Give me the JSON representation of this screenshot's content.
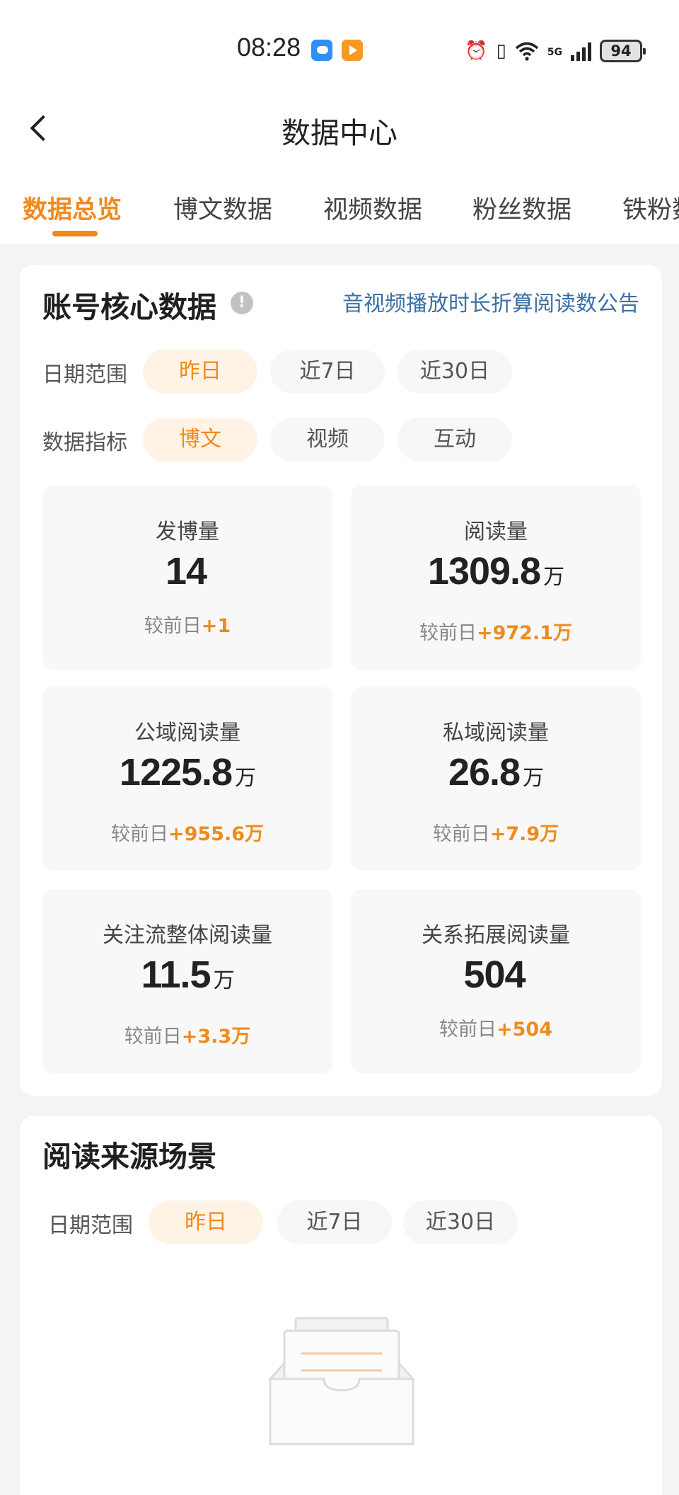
{
  "status_bar": {
    "time": "08:28",
    "battery": "94"
  },
  "nav": {
    "title": "数据中心"
  },
  "tabs": [
    {
      "label": "数据总览",
      "active": true
    },
    {
      "label": "博文数据"
    },
    {
      "label": "视频数据"
    },
    {
      "label": "粉丝数据"
    },
    {
      "label": "铁粉数"
    }
  ],
  "core_card": {
    "title": "账号核心数据",
    "info_icon": "!",
    "notice_link": "音视频播放时长折算阅读数公告",
    "date_range": {
      "label": "日期范围",
      "options": [
        "昨日",
        "近7日",
        "近30日"
      ],
      "selected": "昨日"
    },
    "metric_type": {
      "label": "数据指标",
      "options": [
        "博文",
        "视频",
        "互动"
      ],
      "selected": "博文"
    },
    "metrics": [
      {
        "label": "发博量",
        "value": "14",
        "unit": "",
        "compare_label": "较前日",
        "delta": "+1"
      },
      {
        "label": "阅读量",
        "value": "1309.8",
        "unit": "万",
        "compare_label": "较前日",
        "delta": "+972.1万"
      },
      {
        "label": "公域阅读量",
        "value": "1225.8",
        "unit": "万",
        "compare_label": "较前日",
        "delta": "+955.6万"
      },
      {
        "label": "私域阅读量",
        "value": "26.8",
        "unit": "万",
        "compare_label": "较前日",
        "delta": "+7.9万"
      },
      {
        "label": "关注流整体阅读量",
        "value": "11.5",
        "unit": "万",
        "compare_label": "较前日",
        "delta": "+3.3万"
      },
      {
        "label": "关系拓展阅读量",
        "value": "504",
        "unit": "",
        "compare_label": "较前日",
        "delta": "+504"
      }
    ]
  },
  "source_card": {
    "title": "阅读来源场景",
    "date_range": {
      "label": "日期范围",
      "options": [
        "昨日",
        "近7日",
        "近30日"
      ],
      "selected": "昨日"
    },
    "empty_icon": "empty-inbox-icon"
  },
  "colors": {
    "accent": "#f08a1c",
    "link": "#3a6fa3",
    "background": "#f4f4f4"
  }
}
